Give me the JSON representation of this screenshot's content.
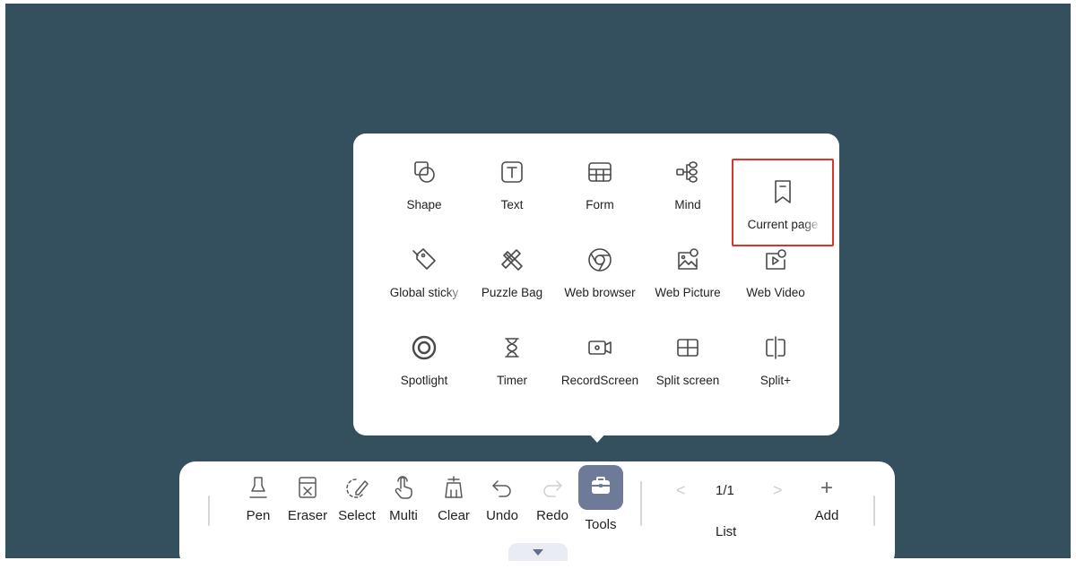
{
  "tools_panel": {
    "items": [
      {
        "label": "Shape",
        "icon": "shape-icon"
      },
      {
        "label": "Text",
        "icon": "text-icon"
      },
      {
        "label": "Form",
        "icon": "form-icon"
      },
      {
        "label": "Mind",
        "icon": "mind-map-icon"
      },
      {
        "label": "Current page",
        "icon": "bookmark-icon",
        "highlighted": true
      },
      {
        "label": "Global sticky",
        "icon": "sticky-pin-icon"
      },
      {
        "label": "Puzzle Bag",
        "icon": "puzzle-bag-icon"
      },
      {
        "label": "Web browser",
        "icon": "browser-icon"
      },
      {
        "label": "Web Picture",
        "icon": "web-picture-icon"
      },
      {
        "label": "Web Video",
        "icon": "web-video-icon"
      },
      {
        "label": "Spotlight",
        "icon": "spotlight-icon"
      },
      {
        "label": "Timer",
        "icon": "hourglass-icon"
      },
      {
        "label": "RecordScreen",
        "icon": "record-screen-icon"
      },
      {
        "label": "Split screen",
        "icon": "split-screen-icon"
      },
      {
        "label": "Split+",
        "icon": "split-plus-icon"
      }
    ]
  },
  "toolbar": {
    "pen": "Pen",
    "eraser": "Eraser",
    "select": "Select",
    "multi": "Multi",
    "clear": "Clear",
    "undo": "Undo",
    "redo": "Redo",
    "tools": "Tools",
    "page_indicator": "1/1",
    "list": "List",
    "add": "Add",
    "prev_symbol": "<",
    "next_symbol": ">",
    "add_symbol": "+"
  },
  "colors": {
    "background": "#34505f",
    "tools_active": "#6d7a98",
    "highlight_border": "#d9352b"
  }
}
